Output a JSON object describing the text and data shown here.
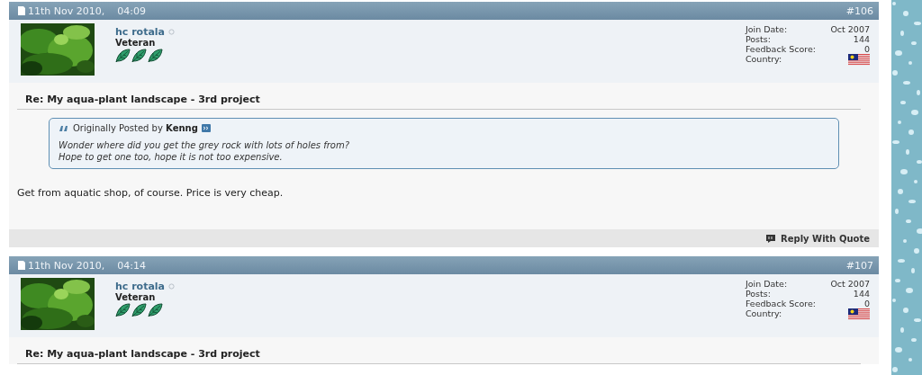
{
  "posts": [
    {
      "date": "11th Nov 2010,",
      "time": "04:09",
      "number": "#106",
      "author": "hc rotala",
      "online": false,
      "rank": "Veteran",
      "stats": [
        {
          "label": "Join Date:",
          "value": "Oct 2007"
        },
        {
          "label": "Posts:",
          "value": "144"
        },
        {
          "label": "Feedback Score:",
          "value": "0"
        },
        {
          "label": "Country:",
          "kind": "flag"
        }
      ],
      "title": "Re: My aqua-plant landscape - 3rd project",
      "quote": {
        "prefix": "Originally Posted by",
        "author": "Kenng",
        "lines": [
          "Wonder where did you get the grey rock with lots of holes from?",
          "Hope to get one too, hope it is not too expensive."
        ]
      },
      "message": "Get from aquatic shop, of course. Price is very cheap.",
      "reply_button": "Reply With Quote"
    },
    {
      "date": "11th Nov 2010,",
      "time": "04:14",
      "number": "#107",
      "author": "hc rotala",
      "online": false,
      "rank": "Veteran",
      "stats": [
        {
          "label": "Join Date:",
          "value": "Oct 2007"
        },
        {
          "label": "Posts:",
          "value": "144"
        },
        {
          "label": "Feedback Score:",
          "value": "0"
        },
        {
          "label": "Country:",
          "kind": "flag"
        }
      ],
      "title": "Re: My aqua-plant landscape - 3rd project"
    }
  ]
}
